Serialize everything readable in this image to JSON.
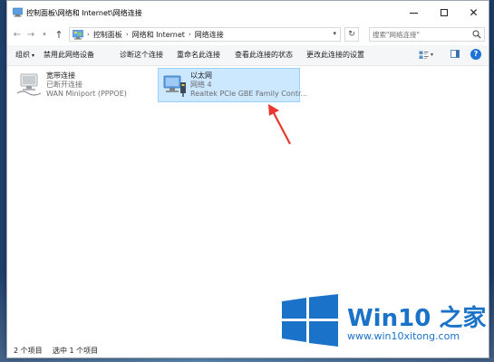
{
  "window": {
    "title": "控制面板\\网络和 Internet\\网络连接"
  },
  "address": {
    "crumbs": [
      "控制面板",
      "网络和 Internet",
      "网络连接"
    ],
    "search_placeholder": "搜索\"网络连接\""
  },
  "toolbar": {
    "organize_label": "组织",
    "disable_label": "禁用此网络设备",
    "diagnose_label": "诊断这个连接",
    "rename_label": "重命名此连接",
    "status_label": "查看此连接的状态",
    "settings_label": "更改此连接的设置"
  },
  "connections": [
    {
      "name": "宽带连接",
      "status": "已断开连接",
      "device": "WAN Miniport (PPPOE)",
      "selected": false,
      "icon": "dialup-connection-icon"
    },
    {
      "name": "以太网",
      "status": "网络 4",
      "device": "Realtek PCIe GBE Family Contr...",
      "selected": true,
      "icon": "ethernet-connection-icon"
    }
  ],
  "statusbar": {
    "item_count": "2 个项目",
    "selected": "选中 1 个项目"
  },
  "watermark": {
    "title": "Win10 之家",
    "url": "www.win10xitong.com"
  },
  "colors": {
    "selection_bg": "#cce8ff",
    "selection_border": "#99d1ff",
    "arrow": "#e8382f",
    "brand_blue": "#1a73c9"
  }
}
